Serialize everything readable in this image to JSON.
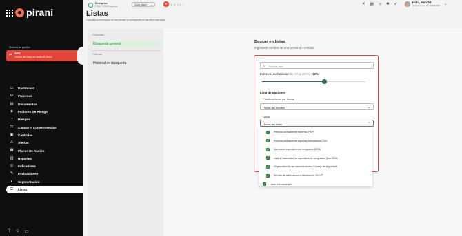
{
  "brand": {
    "logo_text": "pirani"
  },
  "sidebar": {
    "section_label": "Sistema de gestión",
    "active_system": {
      "title": "AML",
      "subtitle": "Gestión del riesgo de lavado de dinero"
    },
    "items": [
      {
        "label": "Dashboard",
        "icon": "monitor-icon"
      },
      {
        "label": "Procesos",
        "icon": "process-icon"
      },
      {
        "label": "Documentos",
        "icon": "document-icon"
      },
      {
        "label": "Factores De Riesgo",
        "icon": "factors-icon"
      },
      {
        "label": "Riesgos",
        "icon": "risk-icon"
      },
      {
        "label": "Causas Y Consecuencias",
        "icon": "causes-icon"
      },
      {
        "label": "Controles",
        "icon": "controls-icon"
      },
      {
        "label": "Alertas",
        "icon": "alert-icon"
      },
      {
        "label": "Planes De Acción",
        "icon": "action-plan-icon"
      },
      {
        "label": "Reportes",
        "icon": "report-icon"
      },
      {
        "label": "Indicadores",
        "icon": "indicator-icon"
      },
      {
        "label": "Evaluaciones",
        "icon": "evaluation-icon"
      },
      {
        "label": "Segmentación",
        "icon": "segmentation-icon"
      },
      {
        "label": "Listas",
        "icon": "list-icon",
        "active": true
      }
    ]
  },
  "header": {
    "org_name": "Enterprise",
    "org_sub": "1.000 - 10000 registros",
    "guide_label": "Guía pirani",
    "rating_badge": "5",
    "stars": "★★★★☆",
    "user_greeting": "Hola, Harold",
    "user_sub": "Organización · ID: 000000000",
    "page_title": "Listas",
    "page_subtitle": "Consulta la información de tus clientes y contrapartes en las diferentes listas"
  },
  "subpanel": {
    "group1_label": "Consultas",
    "item_general": "Búsqueda general",
    "group2_label": "Historial",
    "item_history": "Historial de búsqueda"
  },
  "search": {
    "title": "Buscar en listas",
    "subtitle": "Ingresa el nombre de una persona o entidad",
    "placeholder": "Buscar aquí",
    "confidence_label": "Índice de confiabilidad",
    "confidence_range": "(de 1% a 100%)",
    "confidence_value": "- 60%",
    "confidence_percent": 60,
    "options_head": "Lista de opciones",
    "source_label": "Clasificaciones por fuente",
    "source_value": "Todas las fuentes",
    "lists_label": "Listas",
    "lists_value": "Todas las listas"
  },
  "dropdown": [
    {
      "label": "Persona políticamente expuesta (PEP)",
      "checked": true,
      "parent": false
    },
    {
      "label": "Persona políticamente expuesta internacional (CIA)",
      "checked": true,
      "parent": false
    },
    {
      "label": "Nacionales especialmente designados (SDN)",
      "checked": true,
      "parent": false
    },
    {
      "label": "Lista de nacionales no especialmente designados (Non-SDN)",
      "checked": true,
      "parent": false
    },
    {
      "label": "Organización de las naciones unidas (Consejo de seguridad)",
      "checked": true,
      "parent": false
    },
    {
      "label": "Servicio de administración tributaria Art. 69 CFF",
      "checked": true,
      "parent": false
    },
    {
      "label": "Listas internacionales",
      "checked": true,
      "parent": true
    }
  ],
  "colors": {
    "accent": "#e2453a",
    "sidebar": "#0f0f0f",
    "primary_green": "#2c6e49",
    "check_green": "#2b8a3e"
  }
}
